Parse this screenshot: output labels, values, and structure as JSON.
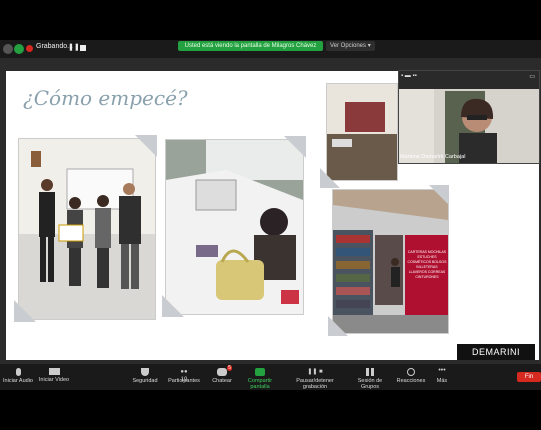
{
  "top_bar": {
    "recording_label": "Grabando...",
    "share_banner": "Usted está viendo la pantalla de Milagros Chávez",
    "view_options": "Ver Opciones"
  },
  "slide": {
    "title": "¿Cómo empecé?",
    "brand": "DEMARINI",
    "sign_text": "CARTERAS MOCHILAS ESTUCHES COSMÉTICOS BOLSOS BILLETERAS LLAVEROS CORREAS CINTURONES"
  },
  "video": {
    "participant_name": "Marlene Demarini Carbajal"
  },
  "toolbar": {
    "items": [
      {
        "label": "Iniciar Audio",
        "icon": "microphone-icon"
      },
      {
        "label": "Iniciar Video",
        "icon": "video-camera-icon"
      },
      {
        "label": "Seguridad",
        "icon": "shield-icon"
      },
      {
        "label": "Participantes",
        "icon": "people-icon",
        "count": "19"
      },
      {
        "label": "Chatear",
        "icon": "chat-icon",
        "badge": "5"
      },
      {
        "label": "Compartir pantalla",
        "icon": "share-screen-icon"
      },
      {
        "label": "Pausar/detener grabación",
        "icon": "pause-record-icon"
      },
      {
        "label": "Sesión de Grupos",
        "icon": "breakout-icon"
      },
      {
        "label": "Reacciones",
        "icon": "smile-icon"
      },
      {
        "label": "Más",
        "icon": "more-icon"
      }
    ],
    "end_label": "Fin"
  },
  "colors": {
    "share_green": "#23a03f",
    "end_red": "#d6291f",
    "title_color": "#8aa1ad"
  }
}
